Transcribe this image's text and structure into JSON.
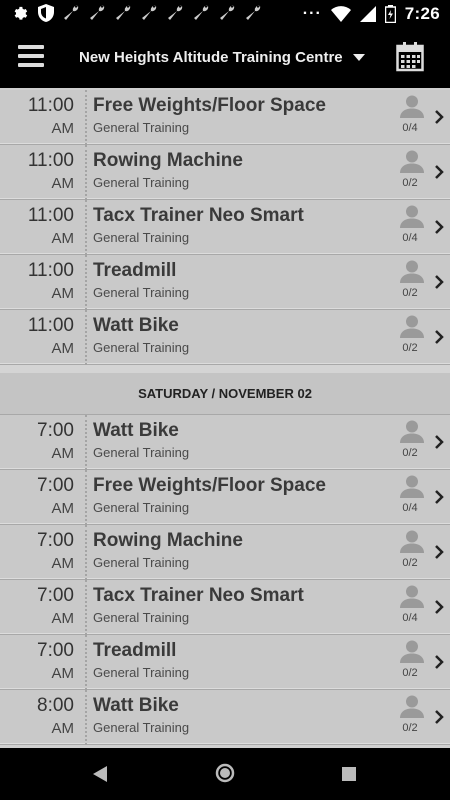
{
  "status_bar": {
    "time": "7:26",
    "overflow_dots": "···",
    "icons": [
      "gear-icon",
      "shield-icon",
      "wrench-icon",
      "wrench-icon",
      "wrench-icon",
      "wrench-icon",
      "wrench-icon",
      "wrench-icon",
      "wrench-icon",
      "wrench-icon",
      "wifi-icon",
      "signal-icon",
      "battery-icon"
    ]
  },
  "app_bar": {
    "title": "New Heights Altitude Training Centre",
    "menu_icon": "hamburger-menu-icon",
    "calendar_icon": "calendar-icon"
  },
  "sessions_top": [
    {
      "hour": "11:00",
      "ampm": "AM",
      "title": "Free Weights/Floor Space",
      "subtitle": "General Training",
      "count": "0/4"
    },
    {
      "hour": "11:00",
      "ampm": "AM",
      "title": "Rowing Machine",
      "subtitle": "General Training",
      "count": "0/2"
    },
    {
      "hour": "11:00",
      "ampm": "AM",
      "title": "Tacx Trainer Neo Smart",
      "subtitle": "General Training",
      "count": "0/4"
    },
    {
      "hour": "11:00",
      "ampm": "AM",
      "title": "Treadmill",
      "subtitle": "General Training",
      "count": "0/2"
    },
    {
      "hour": "11:00",
      "ampm": "AM",
      "title": "Watt Bike",
      "subtitle": "General Training",
      "count": "0/2"
    }
  ],
  "date_header": "SATURDAY / NOVEMBER 02",
  "sessions_saturday": [
    {
      "hour": "7:00",
      "ampm": "AM",
      "title": "Watt Bike",
      "subtitle": "General Training",
      "count": "0/2"
    },
    {
      "hour": "7:00",
      "ampm": "AM",
      "title": "Free Weights/Floor Space",
      "subtitle": "General Training",
      "count": "0/4"
    },
    {
      "hour": "7:00",
      "ampm": "AM",
      "title": "Rowing Machine",
      "subtitle": "General Training",
      "count": "0/2"
    },
    {
      "hour": "7:00",
      "ampm": "AM",
      "title": "Tacx Trainer Neo Smart",
      "subtitle": "General Training",
      "count": "0/4"
    },
    {
      "hour": "7:00",
      "ampm": "AM",
      "title": "Treadmill",
      "subtitle": "General Training",
      "count": "0/2"
    },
    {
      "hour": "8:00",
      "ampm": "AM",
      "title": "Watt Bike",
      "subtitle": "General Training",
      "count": "0/2"
    }
  ],
  "nav_bar": {
    "back_icon": "back-triangle-icon",
    "home_icon": "home-circle-icon",
    "recents_icon": "recents-square-icon"
  },
  "colors": {
    "background": "#cfcfcf",
    "app_bar": "#000000",
    "text": "#3a3a3a"
  }
}
